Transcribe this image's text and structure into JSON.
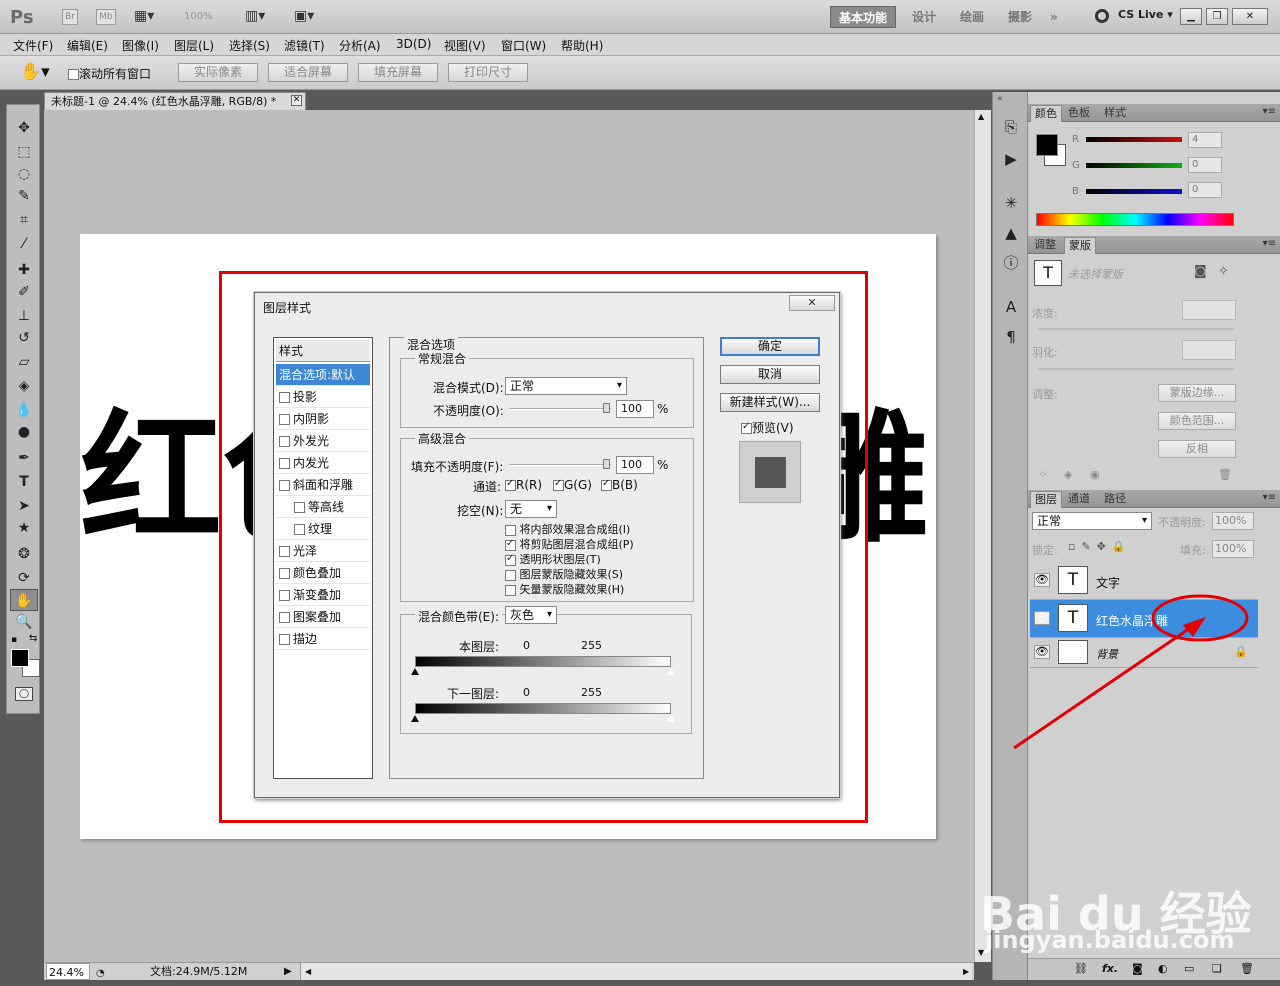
{
  "app": {
    "logo": "Ps",
    "mini_buttons": [
      "Br",
      "Mb"
    ],
    "zoom_display": "100%",
    "workspaces": [
      "基本功能",
      "设计",
      "绘画",
      "摄影"
    ],
    "more_workspaces": "»",
    "cs_live": "CS Live"
  },
  "menu": [
    "文件(F)",
    "编辑(E)",
    "图像(I)",
    "图层(L)",
    "选择(S)",
    "滤镜(T)",
    "分析(A)",
    "3D(D)",
    "视图(V)",
    "窗口(W)",
    "帮助(H)"
  ],
  "options": {
    "scroll_all_label": "滚动所有窗口",
    "buttons": [
      "实际像素",
      "适合屏幕",
      "填充屏幕",
      "打印尺寸"
    ]
  },
  "document": {
    "tab_title": "未标题-1 @ 24.4% (红色水晶浮雕, RGB/8) *",
    "canvas_chars_left": "红色",
    "canvas_chars_right": "雕",
    "zoom": "24.4%",
    "doc_size": "文档:24.9M/5.12M"
  },
  "dialog": {
    "title": "图层样式",
    "styles": {
      "header": "样式",
      "items": [
        {
          "label": "混合选项:默认",
          "checkbox": false,
          "selected": true,
          "indent": false
        },
        {
          "label": "投影",
          "checkbox": true,
          "checked": false,
          "indent": false
        },
        {
          "label": "内阴影",
          "checkbox": true,
          "checked": false,
          "indent": false
        },
        {
          "label": "外发光",
          "checkbox": true,
          "checked": false,
          "indent": false
        },
        {
          "label": "内发光",
          "checkbox": true,
          "checked": false,
          "indent": false
        },
        {
          "label": "斜面和浮雕",
          "checkbox": true,
          "checked": false,
          "indent": false
        },
        {
          "label": "等高线",
          "checkbox": true,
          "checked": false,
          "indent": true
        },
        {
          "label": "纹理",
          "checkbox": true,
          "checked": false,
          "indent": true
        },
        {
          "label": "光泽",
          "checkbox": true,
          "checked": false,
          "indent": false
        },
        {
          "label": "颜色叠加",
          "checkbox": true,
          "checked": false,
          "indent": false
        },
        {
          "label": "渐变叠加",
          "checkbox": true,
          "checked": false,
          "indent": false
        },
        {
          "label": "图案叠加",
          "checkbox": true,
          "checked": false,
          "indent": false
        },
        {
          "label": "描边",
          "checkbox": true,
          "checked": false,
          "indent": false
        }
      ]
    },
    "blend_options": {
      "title": "混合选项",
      "general": {
        "title": "常规混合",
        "mode_label": "混合模式(D):",
        "mode_value": "正常",
        "opacity_label": "不透明度(O):",
        "opacity_value": "100",
        "percent": "%"
      },
      "advanced": {
        "title": "高级混合",
        "fill_label": "填充不透明度(F):",
        "fill_value": "100",
        "percent": "%",
        "channels_label": "通道:",
        "channels": [
          {
            "label": "R(R)",
            "checked": true
          },
          {
            "label": "G(G)",
            "checked": true
          },
          {
            "label": "B(B)",
            "checked": true
          }
        ],
        "knockout_label": "挖空(N):",
        "knockout_value": "无",
        "checks": [
          {
            "label": "将内部效果混合成组(I)",
            "checked": false
          },
          {
            "label": "将剪贴图层混合成组(P)",
            "checked": true
          },
          {
            "label": "透明形状图层(T)",
            "checked": true
          },
          {
            "label": "图层蒙版隐藏效果(S)",
            "checked": false
          },
          {
            "label": "矢量蒙版隐藏效果(H)",
            "checked": false
          }
        ]
      },
      "blend_if": {
        "label": "混合颜色带(E):",
        "value": "灰色",
        "this_layer_label": "本图层:",
        "this_layer_min": "0",
        "this_layer_max": "255",
        "underlying_label": "下一图层:",
        "underlying_min": "0",
        "underlying_max": "255"
      }
    },
    "buttons": {
      "ok": "确定",
      "cancel": "取消",
      "new_style": "新建样式(W)...",
      "preview_label": "预览(V)",
      "preview_checked": true
    }
  },
  "panels": {
    "color": {
      "tabs": [
        "颜色",
        "色板",
        "样式"
      ],
      "channels": [
        {
          "label": "R",
          "value": "4",
          "color": "#d01010"
        },
        {
          "label": "G",
          "value": "0",
          "color": "#10b010"
        },
        {
          "label": "B",
          "value": "0",
          "color": "#1010d0"
        }
      ]
    },
    "masks": {
      "tabs": [
        "调整",
        "蒙版"
      ],
      "no_mask": "未选择蒙版",
      "density_label": "浓度:",
      "feather_label": "羽化:",
      "refine_label": "调整:",
      "buttons": [
        "蒙版边缘...",
        "颜色范围...",
        "反相"
      ]
    },
    "layers": {
      "tabs": [
        "图层",
        "通道",
        "路径"
      ],
      "blend_mode": "正常",
      "opacity_label": "不透明度:",
      "opacity_value": "100%",
      "lock_label": "锁定:",
      "fill_label": "填充:",
      "fill_value": "100%",
      "rows": [
        {
          "name": "文字",
          "type": "text",
          "selected": false
        },
        {
          "name": "红色水晶浮雕",
          "type": "text",
          "selected": true
        },
        {
          "name": "背景",
          "type": "background",
          "selected": false
        }
      ],
      "footer_icons": [
        "link-icon",
        "fx-icon",
        "mask-icon",
        "adjustment-icon",
        "folder-icon",
        "new-layer-icon",
        "trash-icon"
      ]
    }
  },
  "watermark": {
    "brand": "Bai du 经验",
    "url": "jingyan.baidu.com"
  }
}
